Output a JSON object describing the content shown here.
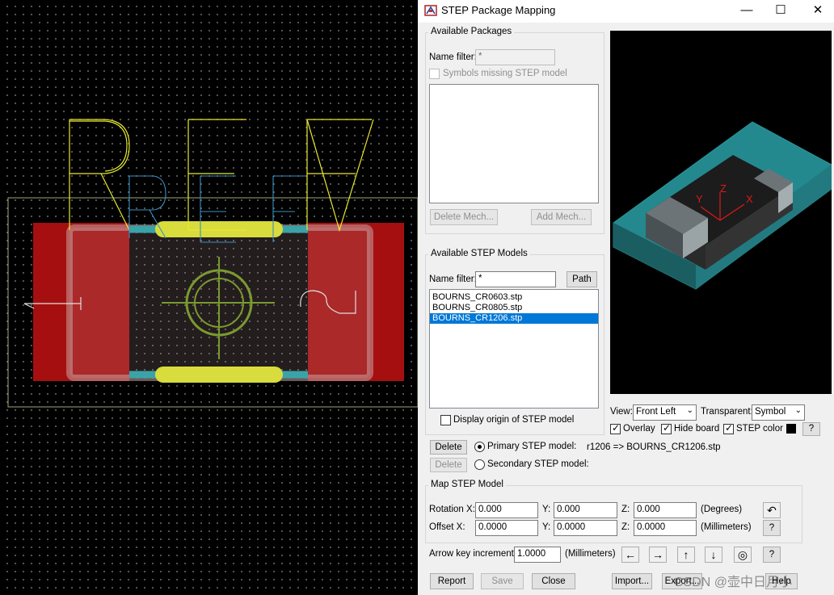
{
  "canvas": {
    "ref_text": "REF",
    "pin_label_1": "1",
    "pin_label_2": "2"
  },
  "window": {
    "title": "STEP Package Mapping",
    "minimize": "—",
    "maximize": "☐",
    "close": "✕"
  },
  "packages": {
    "group_title": "Available Packages",
    "name_filter_label": "Name filter:",
    "name_filter_value": "*",
    "missing_label": "Symbols missing STEP model",
    "delete_mech": "Delete Mech...",
    "add_mech": "Add Mech..."
  },
  "models": {
    "group_title": "Available STEP Models",
    "name_filter_label": "Name filter:",
    "name_filter_value": "*",
    "path_button": "Path",
    "items": [
      "BOURNS_CR0603.stp",
      "BOURNS_CR0805.stp",
      "BOURNS_CR1206.stp"
    ],
    "display_origin_label": "Display origin of STEP model"
  },
  "preview": {
    "axis_x": "X",
    "axis_y": "Y",
    "axis_z": "Z"
  },
  "view_controls": {
    "view_label": "View:",
    "view_value": "Front Left",
    "transparent_label": "Transparent:",
    "transparent_value": "Symbol",
    "overlay_label": "Overlay",
    "hide_board_label": "Hide board",
    "step_color_label": "STEP color",
    "help": "?"
  },
  "mapping": {
    "delete_primary": "Delete",
    "primary_label": "Primary STEP model:",
    "primary_value": "r1206 => BOURNS_CR1206.stp",
    "delete_secondary": "Delete",
    "secondary_label": "Secondary STEP model:"
  },
  "map_step": {
    "group_title": "Map STEP Model",
    "rotation_label": "Rotation X:",
    "offset_label": "Offset X:",
    "y_label": "Y:",
    "z_label": "Z:",
    "rot_x": "0.000",
    "rot_y": "0.000",
    "rot_z": "0.000",
    "off_x": "0.0000",
    "off_y": "0.0000",
    "off_z": "0.0000",
    "degrees": "(Degrees)",
    "millimeters": "(Millimeters)",
    "help": "?"
  },
  "arrow_key": {
    "label": "Arrow key increment:",
    "value": "1.0000",
    "unit": "(Millimeters)",
    "help": "?"
  },
  "footer": {
    "report": "Report",
    "save": "Save",
    "close": "Close",
    "import": "Import...",
    "export": "Export...",
    "help": "Help"
  },
  "watermark": "CSDN @壶中日月小",
  "colors": {
    "pad_red": "#a50f0f",
    "silk_yellow": "#e8e832",
    "teal": "#3aa3a8",
    "selection_blue": "#0078d7"
  }
}
